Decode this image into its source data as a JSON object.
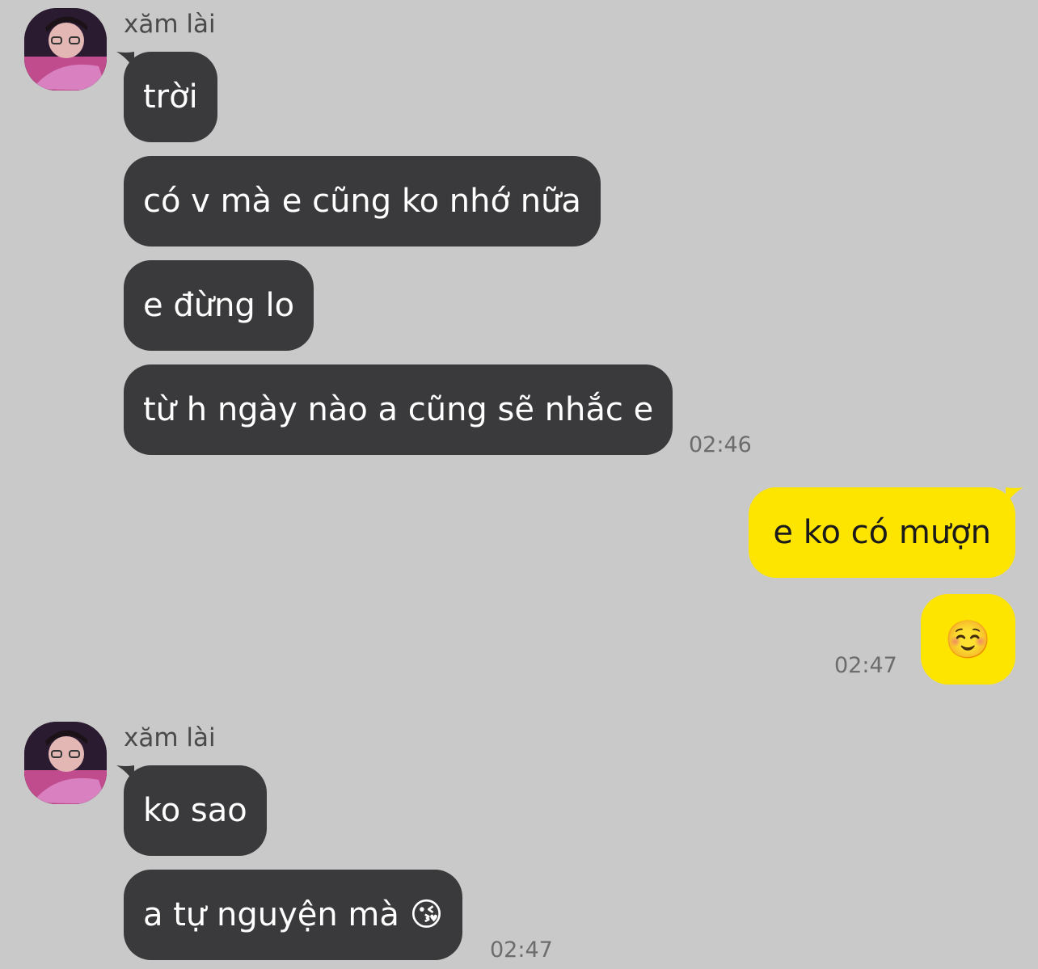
{
  "chat": {
    "group1": {
      "sender": "xăm lài",
      "messages": [
        "trời",
        "có v mà e cũng ko nhớ nữa",
        "e đừng lo",
        "từ h ngày nào a cũng sẽ nhắc e"
      ],
      "time": "02:46"
    },
    "group2": {
      "messages": [
        "e ko có mượn",
        "☺️"
      ],
      "time": "02:47"
    },
    "group3": {
      "sender": "xăm lài",
      "messages": [
        "ko sao",
        "a tự nguyện mà 😘"
      ],
      "time": "02:47"
    }
  },
  "colors": {
    "background": "#c9c9c9",
    "incoming_bubble": "#3a3a3c",
    "outgoing_bubble": "#fee500"
  },
  "icons": {
    "avatar": "profile-photo"
  }
}
